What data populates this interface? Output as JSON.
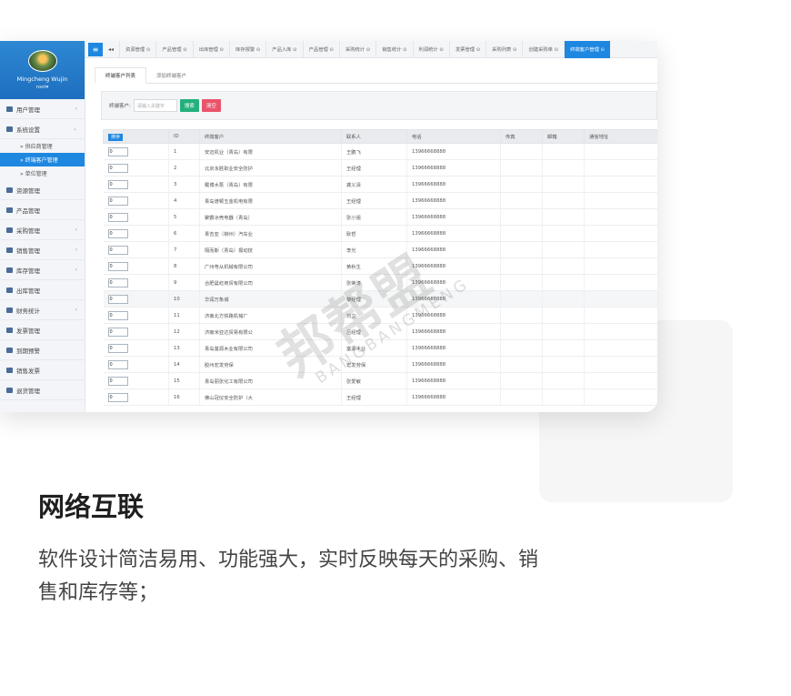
{
  "sidebar": {
    "user_name": "Mingcheng Wujin",
    "user_role": "root",
    "items": [
      {
        "label": "用户管理",
        "arrow": "‹"
      },
      {
        "label": "系统设置",
        "arrow": "⌄"
      },
      {
        "label": "资源管理",
        "arrow": ""
      },
      {
        "label": "产品管理",
        "arrow": ""
      },
      {
        "label": "采购管理",
        "arrow": "‹"
      },
      {
        "label": "销售管理",
        "arrow": "‹"
      },
      {
        "label": "库存管理",
        "arrow": "‹"
      },
      {
        "label": "出库管理",
        "arrow": ""
      },
      {
        "label": "财务统计",
        "arrow": "‹"
      },
      {
        "label": "发票管理",
        "arrow": ""
      },
      {
        "label": "到期预警",
        "arrow": ""
      },
      {
        "label": "销售发票",
        "arrow": ""
      },
      {
        "label": "退货管理",
        "arrow": ""
      }
    ],
    "subitems": [
      {
        "label": "» 供应商管理"
      },
      {
        "label": "» 终端客户管理"
      },
      {
        "label": "» 单位管理"
      }
    ]
  },
  "tabs": {
    "menu_icon": "≡",
    "back": "◂◂",
    "items": [
      "资源管理 ⊙",
      "产品管理 ⊙",
      "出库管理 ⊙",
      "库存报警 ⊙",
      "产品入库 ⊙",
      "产品管理 ⊙",
      "采购统计 ⊙",
      "销售统计 ⊙",
      "利润统计 ⊙",
      "发票管理 ⊙",
      "采购列表 ⊙",
      "创建采购单 ⊙",
      "终端客户管理 ⊙"
    ]
  },
  "subtabs": [
    "终端客户列表",
    "添加终端客户"
  ],
  "search": {
    "label": "终端客户:",
    "placeholder": "请输入关键字",
    "search_btn": "搜索",
    "clear_btn": "清空"
  },
  "table": {
    "headers": [
      "排序",
      "ID",
      "终端客户",
      "联系人",
      "电话",
      "传真",
      "邮箱",
      "通信地址"
    ],
    "rows": [
      {
        "sort": "0",
        "id": "1",
        "name": "安迈机业（青岛）有限",
        "contact": "王鹏飞",
        "phone": "13966668888"
      },
      {
        "sort": "0",
        "id": "2",
        "name": "北京永胜职业安全防护",
        "contact": "王经理",
        "phone": "13966668888"
      },
      {
        "sort": "0",
        "id": "3",
        "name": "戴博水泵（青岛）有限",
        "contact": "龚义清",
        "phone": "13966668888"
      },
      {
        "sort": "0",
        "id": "4",
        "name": "青岛谱顿五金机电有限",
        "contact": "王经理",
        "phone": "13966668888"
      },
      {
        "sort": "0",
        "id": "5",
        "name": "聚霸冰壳电器（青岛）",
        "contact": "张小姐",
        "phone": "13966668888"
      },
      {
        "sort": "0",
        "id": "6",
        "name": "青吉亚（柳州）汽车业",
        "contact": "耿哲",
        "phone": "13966668888"
      },
      {
        "sort": "0",
        "id": "7",
        "name": "隔而斯（青岛）振动技",
        "contact": "李光",
        "phone": "13966668888"
      },
      {
        "sort": "0",
        "id": "8",
        "name": "广州粤从机械有限公司",
        "contact": "黄秋生",
        "phone": "13966668888"
      },
      {
        "sort": "0",
        "id": "9",
        "name": "合肥晨屹商贸有限公司",
        "contact": "张荣涛",
        "phone": "13966668888"
      },
      {
        "sort": "0",
        "id": "10",
        "name": "华润万象城",
        "contact": "黎经理",
        "phone": "13966668888"
      },
      {
        "sort": "0",
        "id": "11",
        "name": "济南北方铁路机械厂",
        "contact": "刘立",
        "phone": "13966668888"
      },
      {
        "sort": "0",
        "id": "12",
        "name": "济南米亚达贸易有限公",
        "contact": "吕经理",
        "phone": "13966668888"
      },
      {
        "sort": "0",
        "id": "13",
        "name": "青岛富源木业有限公司",
        "contact": "富源木业",
        "phone": "13966668888"
      },
      {
        "sort": "0",
        "id": "14",
        "name": "胶州宏发劳保",
        "contact": "宏发劳保",
        "phone": "13966668888"
      },
      {
        "sort": "0",
        "id": "15",
        "name": "青岛丽张化工有限公司",
        "contact": "张爱敏",
        "phone": "13966668888"
      },
      {
        "sort": "0",
        "id": "16",
        "name": "佛山冠仪安全防护（大",
        "contact": "王经理",
        "phone": "13966668888"
      }
    ]
  },
  "watermark": {
    "cn": "邦帮盟",
    "en": "BANGBANGMENG"
  },
  "headline": "网络互联",
  "description": "软件设计简洁易用、功能强大，实时反映每天的采购、销售和库存等；"
}
